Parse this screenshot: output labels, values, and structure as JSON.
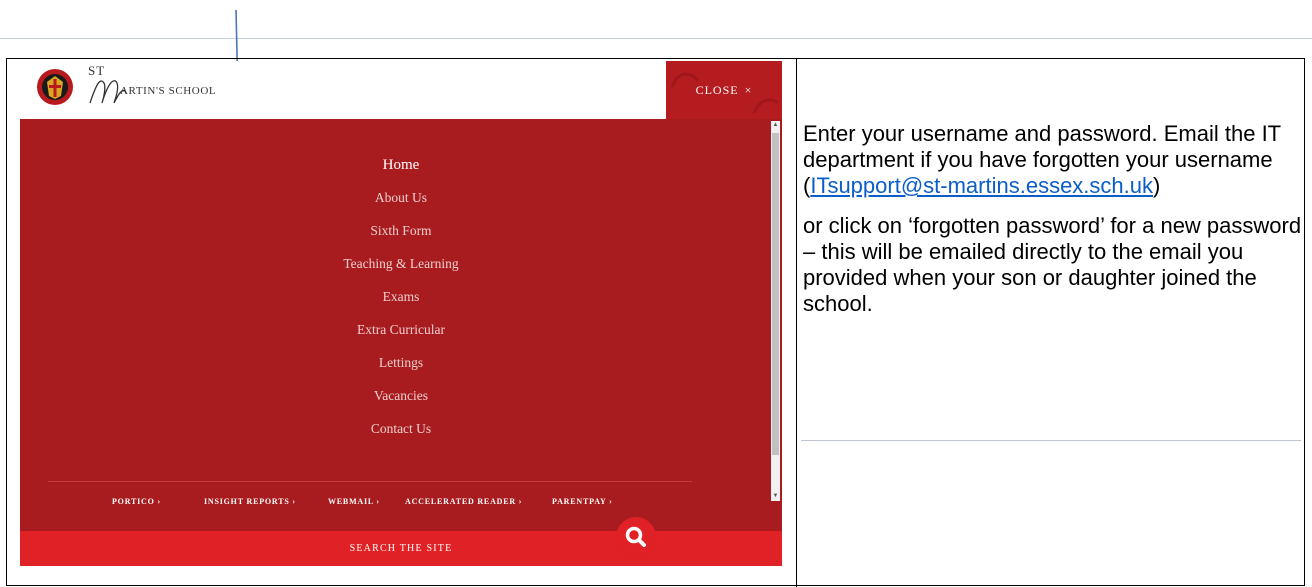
{
  "website": {
    "logo_st": "ST",
    "logo_name": "ARTIN'S SCHOOL",
    "close_label": "CLOSE",
    "close_symbol": "×",
    "menu": [
      {
        "label": "Home",
        "active": true
      },
      {
        "label": "About Us"
      },
      {
        "label": "Sixth Form"
      },
      {
        "label": "Teaching & Learning"
      },
      {
        "label": "Exams"
      },
      {
        "label": "Extra Curricular"
      },
      {
        "label": "Lettings"
      },
      {
        "label": "Vacancies"
      },
      {
        "label": "Contact Us"
      }
    ],
    "quick_links": [
      "PORTICO ›",
      "INSIGHT REPORTS ›",
      "WEBMAIL ›",
      "ACCELERATED READER ›",
      "PARENTPAY ›"
    ],
    "search_label": "SEARCH THE SITE",
    "colors": {
      "menu_bg": "#a81c1f",
      "search_bg": "#e02125",
      "close_bg": "#b51c20"
    }
  },
  "instructions": {
    "line1": "Enter your username and password. Email the IT department if you have forgotten your username (",
    "email": "ITsupport@st-martins.essex.sch.uk",
    "line1_end": ")",
    "line2": "or click on ‘forgotten password’ for a new password – this will be emailed directly to the email you provided when your son or daughter joined the school."
  },
  "icons": [
    "school-crest-icon",
    "close-icon",
    "search-icon",
    "pointer-arrow"
  ]
}
